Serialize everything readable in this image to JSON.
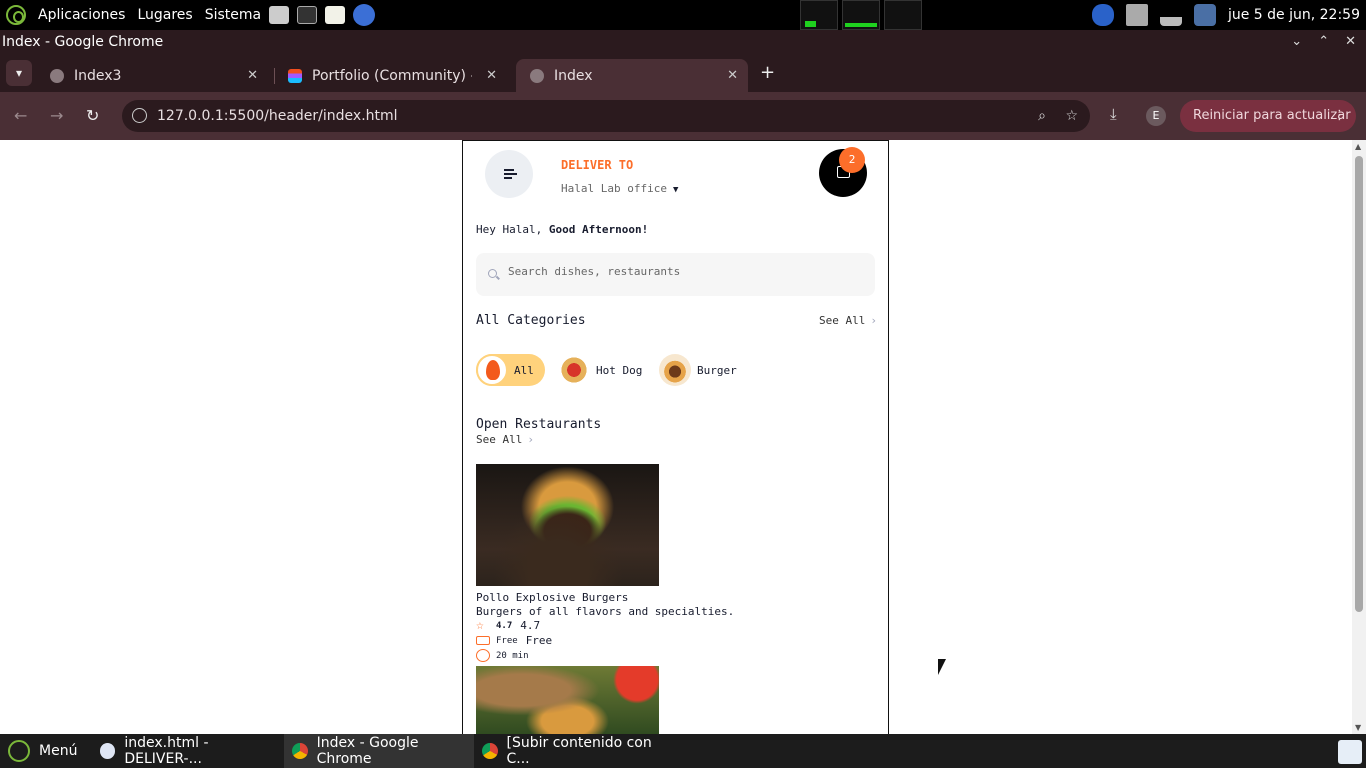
{
  "os_panel": {
    "menu_items": [
      "Aplicaciones",
      "Lugares",
      "Sistema"
    ],
    "clock": "jue  5 de jun, 22:59"
  },
  "window": {
    "title": "Index - Google Chrome",
    "controls": [
      "⌄",
      "⌃",
      "✕"
    ]
  },
  "tabs": [
    {
      "label": "Index3",
      "favicon": "globe-icon",
      "active": false
    },
    {
      "label": "Portfolio (Community) – F",
      "favicon": "figma-icon",
      "active": false
    },
    {
      "label": "Index",
      "favicon": "globe-icon",
      "active": true
    }
  ],
  "toolbar": {
    "url": "127.0.0.1:5500/header/index.html",
    "profile_initial": "E",
    "update_label": "Reiniciar para actualizar"
  },
  "app": {
    "deliver_to_label": "DELIVER TO",
    "location": "Halal Lab office",
    "cart_count": "2",
    "greeting_prefix": "Hey Halal,",
    "greeting_bold": "Good Afternoon!",
    "search_placeholder": "Search dishes, restaurants",
    "categories_title": "All Categories",
    "see_all": "See All",
    "categories": [
      {
        "label": "All",
        "icon": "flame-icon",
        "active": true
      },
      {
        "label": "Hot Dog",
        "icon": "hotdog-icon",
        "active": false
      },
      {
        "label": "Burger",
        "icon": "burger-icon",
        "active": false
      }
    ],
    "restaurants_title": "Open Restaurants",
    "restaurants": [
      {
        "name": "Pollo Explosive Burgers",
        "description": "Burgers of all flavors and specialties.",
        "rating_small": "4.7",
        "rating": "4.7",
        "delivery_small": "Free",
        "delivery": "Free",
        "time": "20 min"
      }
    ]
  },
  "taskbar": {
    "items": [
      {
        "label": "Menú",
        "active": false
      },
      {
        "label": "index.html - DELIVER-...",
        "active": false
      },
      {
        "label": "Index - Google Chrome",
        "active": true
      },
      {
        "label": "[Subir contenido con C...",
        "active": false
      }
    ]
  },
  "colors": {
    "accent": "#fc6e2a",
    "category_active": "#ffd27c",
    "chrome_dark": "#2b1a1e",
    "chrome_toolbar": "#4a2f35",
    "update_button": "#7a3040"
  }
}
